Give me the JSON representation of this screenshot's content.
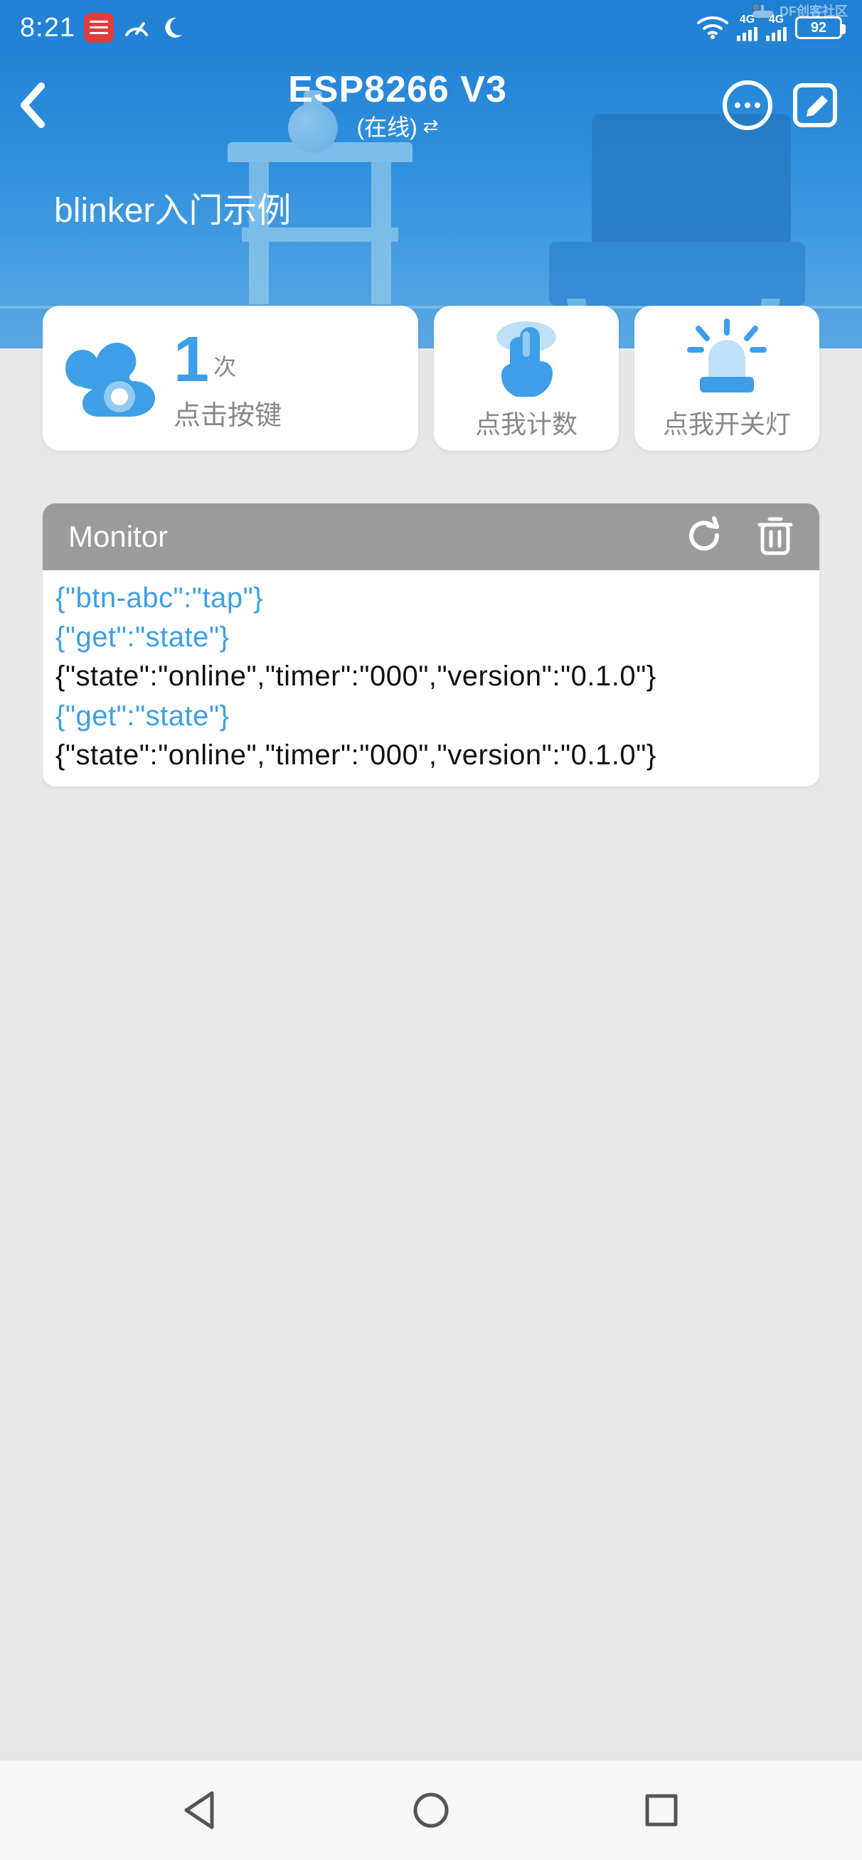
{
  "statusbar": {
    "time": "8:21",
    "battery": "92",
    "net1_label": "4G",
    "net2_label": "4G"
  },
  "watermark": {
    "text": "DF创客社区"
  },
  "header": {
    "title": "ESP8266 V3",
    "status": "(在线)",
    "subtitle": "blinker入门示例"
  },
  "cards": {
    "counter": {
      "value": "1",
      "unit": "次",
      "label": "点击按键"
    },
    "tap": {
      "label": "点我计数"
    },
    "light": {
      "label": "点我开关灯"
    }
  },
  "monitor": {
    "title": "Monitor",
    "lines": [
      {
        "text": "{\"btn-abc\":\"tap\"}",
        "kind": "blue"
      },
      {
        "text": "{\"get\":\"state\"}",
        "kind": "blue"
      },
      {
        "text": "{\"state\":\"online\",\"timer\":\"000\",\"version\":\"0.1.0\"}",
        "kind": "black"
      },
      {
        "text": "{\"get\":\"state\"}",
        "kind": "blue"
      },
      {
        "text": "{\"state\":\"online\",\"timer\":\"000\",\"version\":\"0.1.0\"}",
        "kind": "black"
      }
    ]
  },
  "colors": {
    "accent": "#3d9fe8",
    "hero_top": "#1e7fd4",
    "hero_bot": "#5ba9e4",
    "muted": "#888888"
  }
}
